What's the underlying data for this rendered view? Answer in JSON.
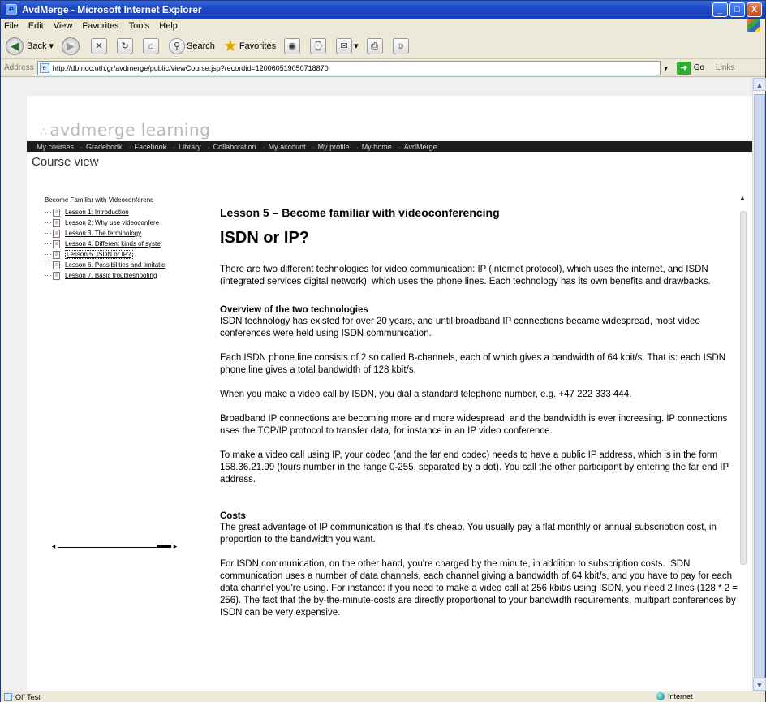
{
  "window": {
    "title": "AvdMerge - Microsoft Internet Explorer",
    "buttons": [
      "_",
      "□",
      "X"
    ]
  },
  "menu": [
    "File",
    "Edit",
    "View",
    "Favorites",
    "Tools",
    "Help"
  ],
  "toolbar": {
    "back": "Back",
    "search": "Search",
    "favorites": "Favorites"
  },
  "address": {
    "label": "Address",
    "url": "http://db.noc.uth.gr/avdmerge/public/viewCourse.jsp?recordid=120060519050718870",
    "go": "Go",
    "links": "Links"
  },
  "site": {
    "logo": "avdmerge learning",
    "nav": [
      "My courses",
      "Gradebook",
      "Facebook",
      "Library",
      "Collaboration",
      "My account",
      "My profile",
      "My home",
      "AvdMerge"
    ],
    "page_title": "Course view"
  },
  "tree": {
    "root": "Become Familiar with Videoconferenc",
    "items": [
      {
        "label": "Lesson 1: Introduction",
        "selected": false
      },
      {
        "label": "Lesson 2: Why use videoconfere",
        "selected": false
      },
      {
        "label": "Lesson 3. The terminology",
        "selected": false
      },
      {
        "label": "Lesson 4. Different kinds of syste",
        "selected": false
      },
      {
        "label": "Lesson 5. ISDN or IP?",
        "selected": true
      },
      {
        "label": "Lesson 6. Possibilities and limitatic",
        "selected": false
      },
      {
        "label": "Lesson 7. Basic troubleshooting",
        "selected": false
      }
    ]
  },
  "article": {
    "lesson": "Lesson 5 – Become familiar with videoconferencing",
    "heading": "ISDN or IP?",
    "intro": "There are two different technologies for video communication: IP (internet protocol), which uses the internet, and ISDN (integrated services digital network), which uses the phone lines. Each technology has its own benefits and drawbacks.",
    "overview_heading": "Overview of the two technologies",
    "overview_p1": "ISDN technology has existed for over 20 years, and until broadband IP connections became widespread, most video conferences were held using ISDN communication.",
    "overview_p2": "Each ISDN phone line consists of 2 so called B-channels, each of which gives a bandwidth of 64 kbit/s. That is: each ISDN phone line gives a total bandwidth of 128 kbit/s.",
    "overview_p3": "When you make a video call by ISDN, you dial a standard telephone number, e.g. +47 222 333 444.",
    "overview_p4": "Broadband IP connections are becoming more and more widespread, and the bandwidth is ever increasing. IP connections uses the TCP/IP protocol to transfer data, for instance in an IP video conference.",
    "overview_p5": "To make a video call using IP, your codec (and the far end codec) needs to have a public IP address, which is in the form 158.36.21.99 (fours number in the range 0-255, separated by a dot). You call the other participant by entering the far end IP address.",
    "costs_heading": "Costs",
    "costs_p1": "The great advantage of IP communication is that it's cheap. You usually pay a flat monthly or annual subscription cost, in proportion to the bandwidth you want.",
    "costs_p2": "For ISDN communication, on the other hand, you're charged by the minute, in addition to subscription costs. ISDN communication uses a number of data channels, each channel giving a bandwidth of 64 kbit/s, and you have to pay for each data channel you're using. For instance: if you need to make a video call at 256 kbit/s using ISDN, you need 2 lines (128 * 2 = 256). The fact that the by-the-minute-costs are directly proportional to your bandwidth requirements, multipart conferences by ISDN can be very expensive."
  },
  "status": {
    "left": "Off Test",
    "zone": "Internet"
  }
}
